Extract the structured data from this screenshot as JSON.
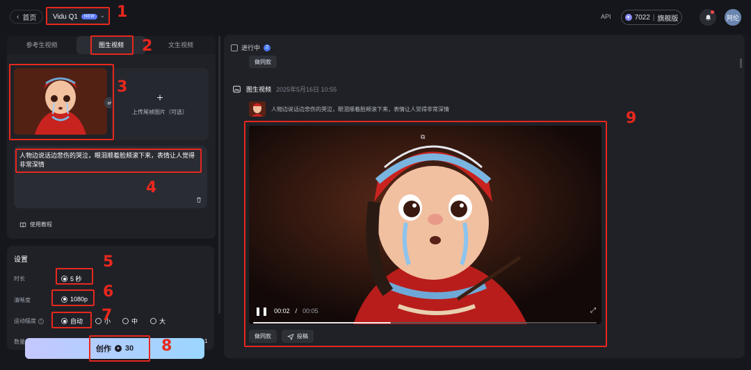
{
  "header": {
    "back_label": "首页",
    "model_name": "Vidu Q1",
    "model_badge": "NEW",
    "api_label": "API",
    "credits": "7022",
    "plan": "旗舰版",
    "avatar_label": "阿伦"
  },
  "tabs": [
    {
      "label": "参考生视频"
    },
    {
      "label": "图生视频"
    },
    {
      "label": "文生视频"
    }
  ],
  "upload": {
    "end_frame_label": "上传尾帧图片（可选）"
  },
  "prompt": {
    "text": "人物边说话边悲伤的哭泣，眼泪顺着脸颊滚下来，表情让人觉得非常深情"
  },
  "tutorial_label": "使用教程",
  "settings": {
    "title": "设置",
    "duration_label": "时长",
    "duration_value": "5 秒",
    "resolution_label": "清晰度",
    "resolution_value": "1080p",
    "motion_label": "运动幅度",
    "motion_options": [
      "自动",
      "小",
      "中",
      "大"
    ],
    "count_label": "数量",
    "count_value": "1"
  },
  "create_button": {
    "label": "创作",
    "cost": "30"
  },
  "feed": {
    "in_progress_label": "进行中",
    "in_progress_count": "2",
    "same_style_label": "做同款",
    "task_type": "图生视频",
    "task_date": "2025年5月16日 10:55",
    "task_prompt": "人物边说话边悲伤的哭泣，眼泪顺着脸颊滚下来，表情让人觉得非常深情",
    "video": {
      "current_time": "00:02",
      "total_time": "00:05",
      "progress": 0.4
    },
    "actions": [
      "做同款",
      "投稿"
    ]
  },
  "annotations": [
    "1",
    "2",
    "3",
    "4",
    "5",
    "6",
    "7",
    "8",
    "9"
  ],
  "colors": {
    "accent": "#5b7cfa",
    "annotation_red": "#e8281e",
    "create_gradient_start": "#c4c8ff",
    "create_gradient_end": "#9ad6ff"
  }
}
